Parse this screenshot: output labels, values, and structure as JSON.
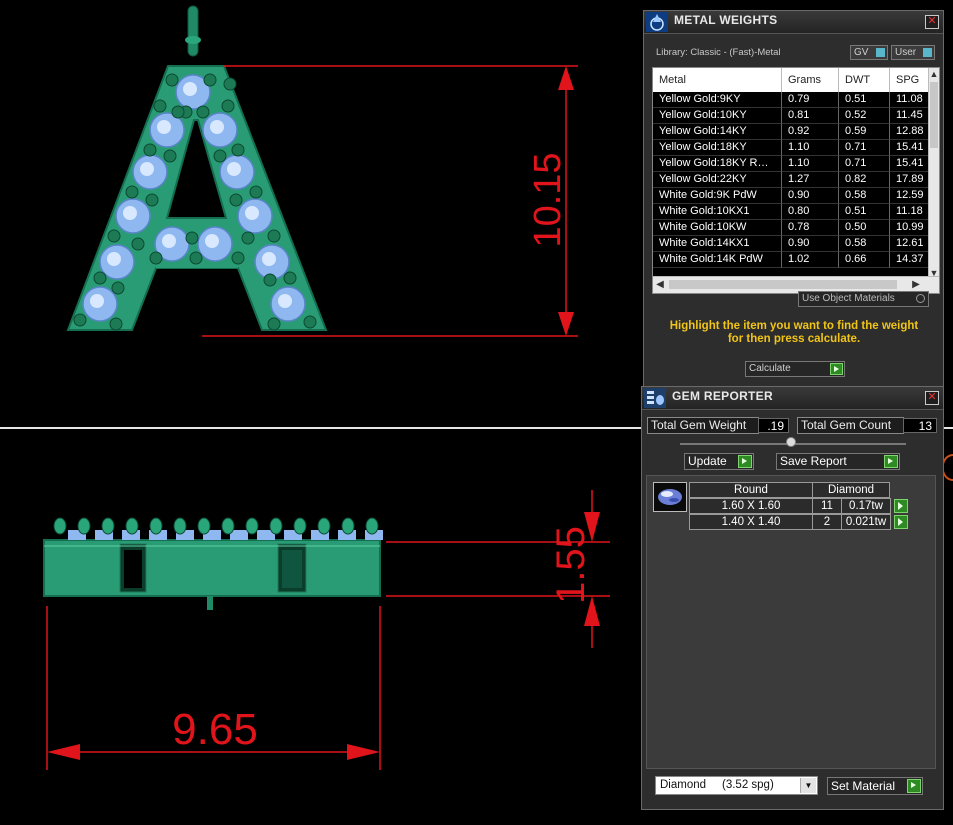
{
  "viewport": {
    "dimensions": {
      "front_height": "10.15",
      "side_height": "1.55",
      "width": "9.65"
    },
    "colors": {
      "dimension": "#e0141a",
      "metal": "#2ea07a",
      "gem": "#9cc8ff",
      "divider": "#ffffff"
    }
  },
  "metal_weights": {
    "title": "METAL WEIGHTS",
    "close": "✕",
    "library": "Library: Classic - (Fast)-Metal",
    "gv_label": "GV",
    "user_label": "User",
    "columns": [
      "Metal",
      "Grams",
      "DWT",
      "SPG"
    ],
    "rows": [
      [
        "Yellow Gold:9KY",
        "0.79",
        "0.51",
        "11.08"
      ],
      [
        "Yellow Gold:10KY",
        "0.81",
        "0.52",
        "11.45"
      ],
      [
        "Yellow Gold:14KY",
        "0.92",
        "0.59",
        "12.88"
      ],
      [
        "Yellow Gold:18KY",
        "1.10",
        "0.71",
        "15.41"
      ],
      [
        "Yellow Gold:18KY R…",
        "1.10",
        "0.71",
        "15.41"
      ],
      [
        "Yellow Gold:22KY",
        "1.27",
        "0.82",
        "17.89"
      ],
      [
        "White Gold:9K PdW",
        "0.90",
        "0.58",
        "12.59"
      ],
      [
        "White Gold:10KX1",
        "0.80",
        "0.51",
        "11.18"
      ],
      [
        "White Gold:10KW",
        "0.78",
        "0.50",
        "10.99"
      ],
      [
        "White Gold:14KX1",
        "0.90",
        "0.58",
        "12.61"
      ],
      [
        "White Gold:14K PdW",
        "1.02",
        "0.66",
        "14.37"
      ]
    ],
    "use_object_materials": "Use Object Materials",
    "hint_line1": "Highlight the item you want to find the weight",
    "hint_line2": "for then press calculate.",
    "calculate": "Calculate",
    "accent": "#f0c419"
  },
  "gem_reporter": {
    "title": "GEM REPORTER",
    "close": "✕",
    "total_weight_label": "Total Gem Weight",
    "total_weight_value": ".19",
    "total_count_label": "Total Gem Count",
    "total_count_value": "13",
    "update": "Update",
    "save_report": "Save Report",
    "report": {
      "shape": "Round",
      "material": "Diamond",
      "rows": [
        {
          "size": "1.60 X 1.60",
          "count": "11",
          "weight": "0.17tw"
        },
        {
          "size": "1.40 X 1.40",
          "count": "2",
          "weight": "0.021tw"
        }
      ]
    },
    "material_select": "Diamond     (3.52 spg)",
    "set_material": "Set Material"
  }
}
